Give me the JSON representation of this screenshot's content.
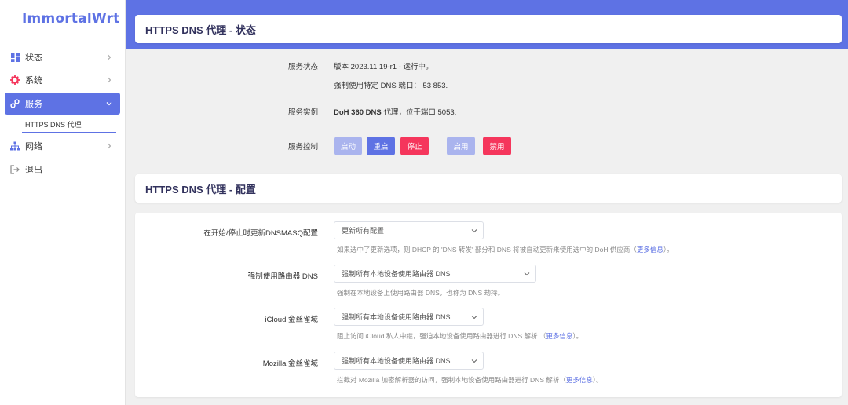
{
  "brand": {
    "logo": "ImmortalWrt",
    "accent": "#5e72e4",
    "danger": "#f5365c"
  },
  "sidebar": {
    "items": [
      {
        "label": "状态",
        "icon": "dashboard-icon"
      },
      {
        "label": "系统",
        "icon": "gear-icon"
      },
      {
        "label": "服务",
        "icon": "services-icon"
      },
      {
        "label": "网络",
        "icon": "network-icon"
      },
      {
        "label": "退出",
        "icon": "logout-icon"
      }
    ],
    "sub_item": "HTTPS DNS 代理"
  },
  "status_card": {
    "title": "HTTPS DNS 代理 - 状态",
    "service_status_label": "服务状态",
    "service_status_line1": "版本 2023.11.19-r1 - 运行中。",
    "service_status_line2": "强制使用特定 DNS 端口： 53 853.",
    "instance_label": "服务实例",
    "instance_bold": "DoH 360 DNS",
    "instance_rest": " 代理，位于端口 5053.",
    "control_label": "服务控制",
    "buttons": {
      "start": "启动",
      "restart": "重启",
      "stop": "停止",
      "enable": "启用",
      "disable": "禁用"
    }
  },
  "config_card": {
    "title": "HTTPS DNS 代理 - 配置",
    "fields": [
      {
        "label": "在开始/停止时更新DNSMASQ配置",
        "value": "更新所有配置",
        "help_prefix": "如果选中了更新选项，则 DHCP 的 'DNS 转发' 部分和 DNS 将被自动更新来使用选中的 DoH 供应商（",
        "help_link": "更多信息",
        "help_suffix": "）。"
      },
      {
        "label": "强制使用路由器 DNS",
        "value": "强制所有本地设备使用路由器 DNS",
        "help_prefix": "强制在本地设备上使用路由器 DNS，也称为 DNS 劫持。",
        "help_link": "",
        "help_suffix": ""
      },
      {
        "label": "iCloud 金丝雀域",
        "value": "强制所有本地设备使用路由器 DNS",
        "help_prefix": "阻止访问 iCloud 私人中继，强迫本地设备使用路由器进行 DNS 解析 （",
        "help_link": "更多信息",
        "help_suffix": "）。"
      },
      {
        "label": "Mozilla 金丝雀域",
        "value": "强制所有本地设备使用路由器 DNS",
        "help_prefix": "拦截对 Mozilla 加密解析器的访问，强制本地设备使用路由器进行 DNS 解析（",
        "help_link": "更多信息",
        "help_suffix": "）。"
      }
    ]
  }
}
